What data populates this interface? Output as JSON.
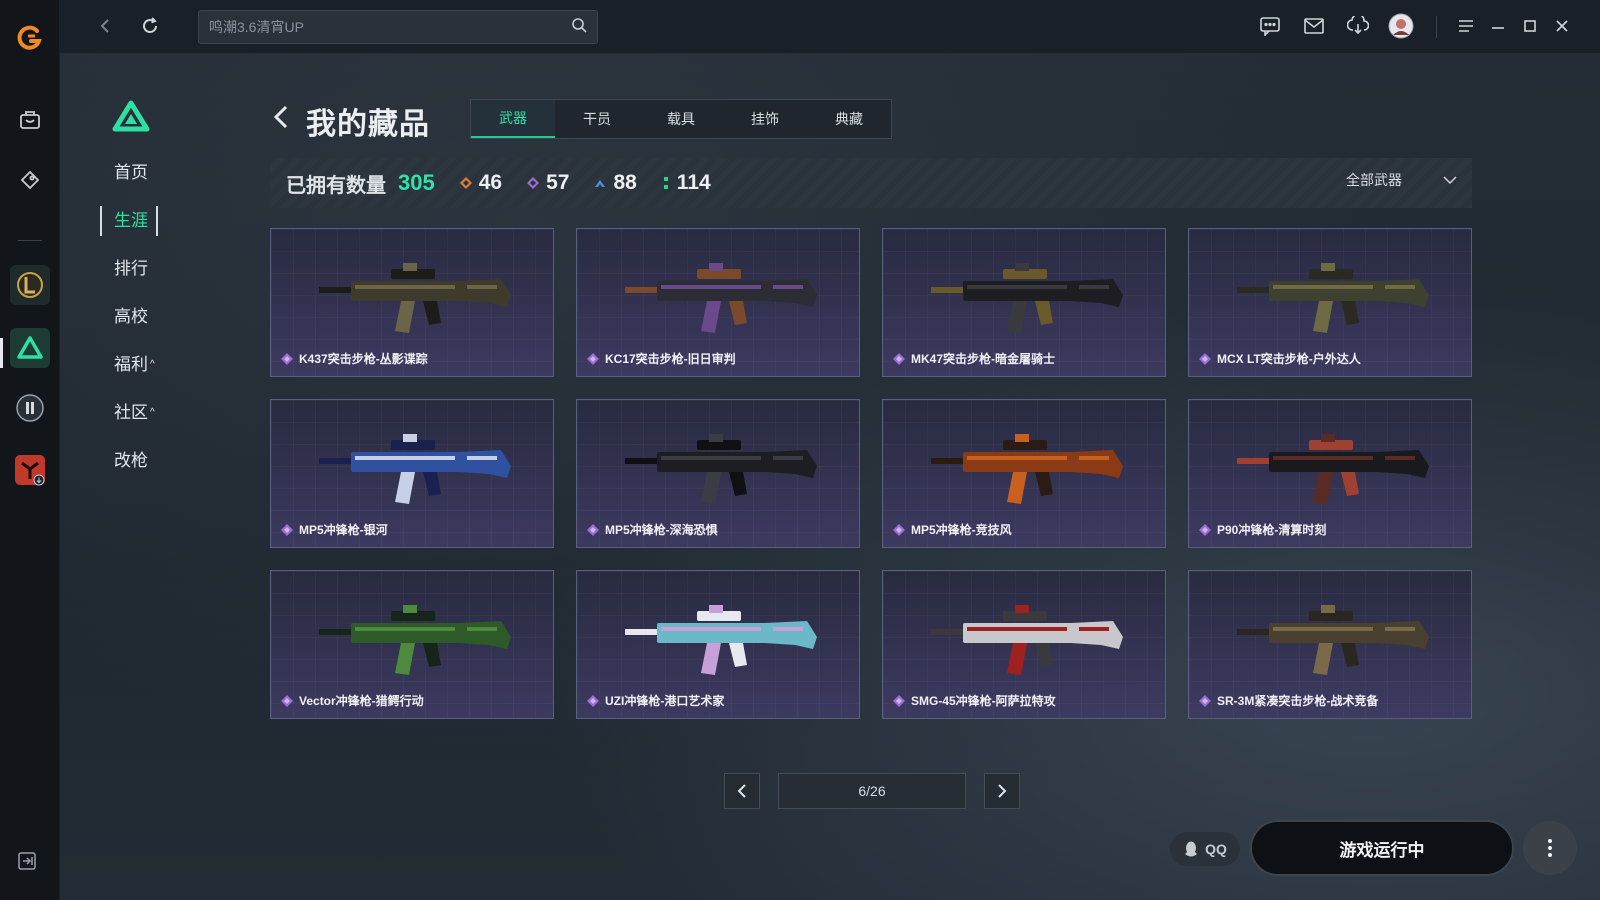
{
  "search": {
    "placeholder": "鸣潮3.6清宵UP"
  },
  "game_nav": {
    "items": [
      {
        "label": "首页"
      },
      {
        "label": "生涯"
      },
      {
        "label": "排行"
      },
      {
        "label": "高校"
      },
      {
        "label": "福利"
      },
      {
        "label": "社区"
      },
      {
        "label": "改枪"
      }
    ]
  },
  "header": {
    "title": "我的藏品",
    "tabs": [
      "武器",
      "干员",
      "载具",
      "挂饰",
      "典藏"
    ],
    "active_tab": "武器"
  },
  "stats": {
    "owned_label": "已拥有数量",
    "owned_total": "305",
    "tiers": [
      {
        "value": "46",
        "color": "#e07a3a"
      },
      {
        "value": "57",
        "color": "#9b6bd6"
      },
      {
        "value": "88",
        "color": "#4c8ee0"
      },
      {
        "value": "114",
        "color": "#2fd08f"
      }
    ],
    "filter_label": "全部武器"
  },
  "items": [
    {
      "name": "K437突击步枪-丛影谍踪",
      "palette": [
        "#3e3a2c",
        "#6a6448",
        "#1d1c18"
      ]
    },
    {
      "name": "KC17突击步枪-旧日审判",
      "palette": [
        "#2c2c34",
        "#6a4a8a",
        "#7a4a2a"
      ]
    },
    {
      "name": "MK47突击步枪-暗金屠骑士",
      "palette": [
        "#1e1e22",
        "#3a3a3e",
        "#6a5a2a"
      ]
    },
    {
      "name": "MCX LT突击步枪-户外达人",
      "palette": [
        "#3e4030",
        "#6e6a44",
        "#2a2a22"
      ]
    },
    {
      "name": "MP5冲锋枪-银河",
      "palette": [
        "#3050a0",
        "#c8d0e8",
        "#1a2050"
      ]
    },
    {
      "name": "MP5冲锋枪-深海恐惧",
      "palette": [
        "#1c1e22",
        "#3a3e44",
        "#0e1012"
      ]
    },
    {
      "name": "MP5冲锋枪-竞技风",
      "palette": [
        "#8a3a14",
        "#c86020",
        "#2a1c14"
      ]
    },
    {
      "name": "P90冲锋枪-清算时刻",
      "palette": [
        "#1a1a1e",
        "#5a2a24",
        "#a04030"
      ]
    },
    {
      "name": "Vector冲锋枪-猎鳄行动",
      "palette": [
        "#2e5a2a",
        "#4e8a3e",
        "#16241a"
      ]
    },
    {
      "name": "UZI冲锋枪-港口艺术家",
      "palette": [
        "#6ab8c8",
        "#c8a0d8",
        "#e8e8f0"
      ]
    },
    {
      "name": "SMG-45冲锋枪-阿萨拉特攻",
      "palette": [
        "#c8c8cc",
        "#a02020",
        "#3a3a3e"
      ]
    },
    {
      "name": "SR-3M紧凑突击步枪-战术竞备",
      "palette": [
        "#4a4030",
        "#7a6a4a",
        "#2a2620"
      ]
    }
  ],
  "pagination": {
    "current": "6/26"
  },
  "bottom": {
    "qq_label": "QQ",
    "launch_label": "游戏运行中"
  },
  "icons": {
    "rail": [
      "app-logo-icon",
      "bag-icon",
      "game-tag-icon",
      "league-icon",
      "delta-icon",
      "pause-icon",
      "red-game-icon"
    ],
    "topbar": [
      "back-icon",
      "refresh-icon",
      "search-icon",
      "chat-icon",
      "mail-icon",
      "download-icon",
      "avatar",
      "menu-icon",
      "minimize-icon",
      "maximize-icon",
      "close-icon"
    ]
  },
  "colors": {
    "accent": "#2fe0a4",
    "rarity_purple": "#9b6bd6",
    "card_border": "#5a5f80"
  }
}
